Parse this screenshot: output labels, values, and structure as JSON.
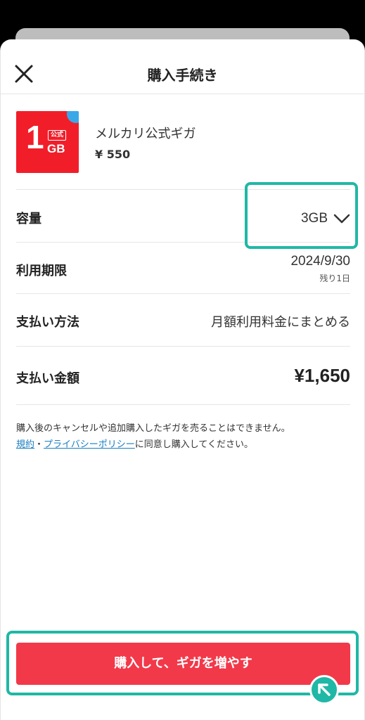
{
  "header": {
    "title": "購入手続き",
    "close_icon": "close-icon"
  },
  "product": {
    "thumb_number": "1",
    "thumb_badge": "公式",
    "thumb_unit": "GB",
    "name": "メルカリ公式ギガ",
    "price": "¥ 550"
  },
  "capacity": {
    "label": "容量",
    "value": "3GB",
    "icon": "chevron-down-icon"
  },
  "expiry": {
    "label": "利用期限",
    "date": "2024/9/30",
    "remaining": "残り1日"
  },
  "payment_method": {
    "label": "支払い方法",
    "value": "月額利用料金にまとめる"
  },
  "payment_amount": {
    "label": "支払い金額",
    "value": "¥1,650"
  },
  "notice": {
    "line1": "購入後のキャンセルや追加購入したギガを売ることはできません。",
    "terms_link": "規約",
    "separator": "・",
    "privacy_link": "プライバシーポリシー",
    "line2_suffix": "に同意し購入してください。"
  },
  "cta": {
    "label": "購入して、ギガを増やす"
  },
  "colors": {
    "accent_red": "#f2394a",
    "highlight_teal": "#1fb8a6",
    "link_blue": "#1a7fc1",
    "thumb_red": "#f11e2a"
  }
}
